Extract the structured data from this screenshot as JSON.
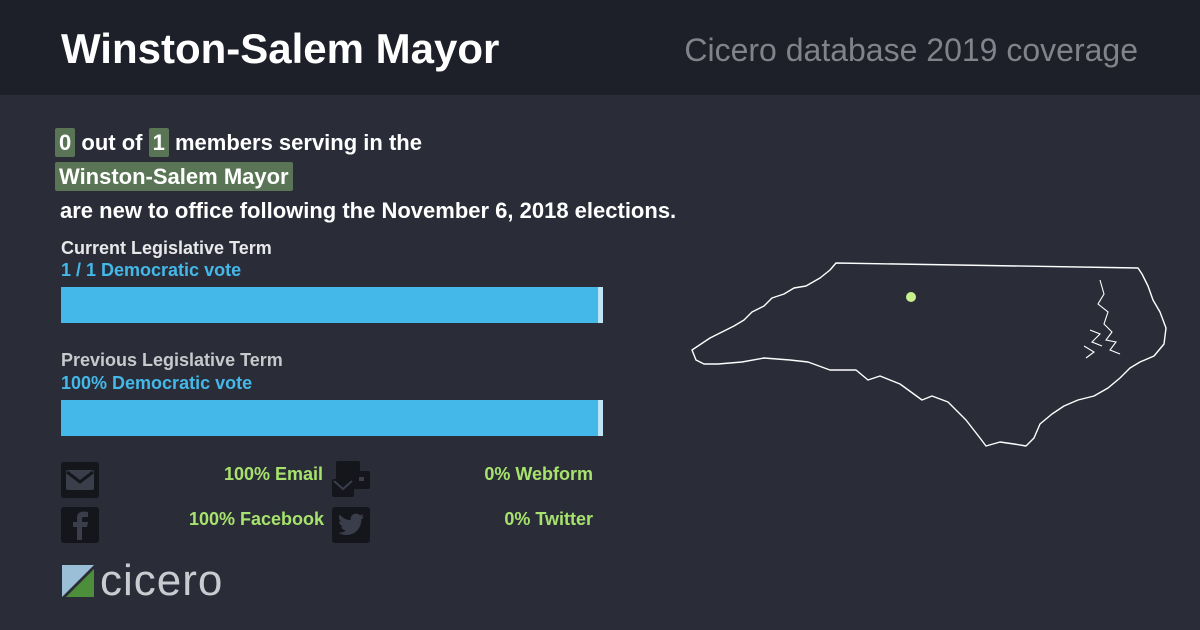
{
  "header": {
    "title": "Winston-Salem Mayor",
    "subtitle": "Cicero database 2019 coverage"
  },
  "summary": {
    "new_count": "0",
    "out_of": "out of",
    "total": "1",
    "members_text": "members serving in the",
    "body_name": "Winston-Salem Mayor",
    "trailing_text": "are new to office following the November 6, 2018 elections."
  },
  "current_term": {
    "title": "Current Legislative Term",
    "vote_text": "1 / 1 Democratic vote",
    "democratic_share": 0.99
  },
  "previous_term": {
    "title": "Previous Legislative Term",
    "vote_text": "100% Democratic vote",
    "democratic_share": 0.99
  },
  "contacts": [
    {
      "icon": "email-icon",
      "label": "100% Email"
    },
    {
      "icon": "webform-icon",
      "label": "0% Webform"
    },
    {
      "icon": "facebook-icon",
      "label": "100% Facebook"
    },
    {
      "icon": "twitter-icon",
      "label": "0% Twitter"
    }
  ],
  "logo": {
    "text": "cicero"
  },
  "colors": {
    "background": "#2a2d38",
    "header": "#1d2029",
    "highlight": "#5a7555",
    "democratic": "#44b8e8",
    "contact_text": "#a7e26c",
    "map_marker": "#c8f08c"
  }
}
